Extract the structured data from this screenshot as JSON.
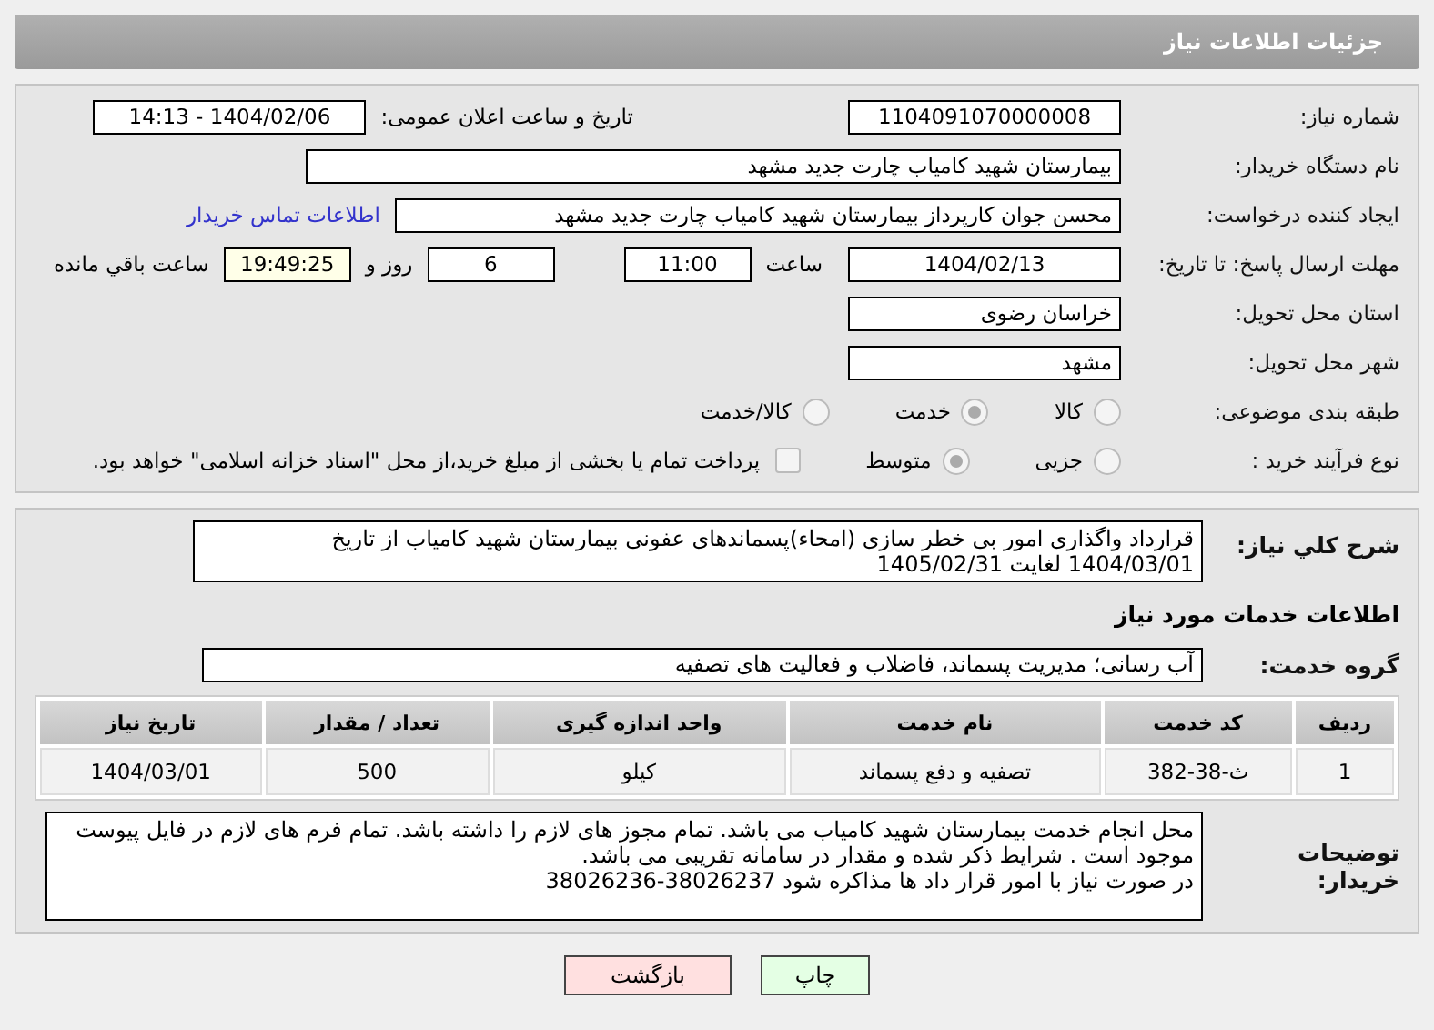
{
  "header": {
    "title": "جزئیات اطلاعات نیاز"
  },
  "info": {
    "need_number": {
      "label": "شماره نیاز:",
      "value": "1104091070000008"
    },
    "announce": {
      "label": "تاریخ و ساعت اعلان عمومی:",
      "value": "1404/02/06 - 14:13"
    },
    "buyer": {
      "label": "نام دستگاه خریدار:",
      "value": "بیمارستان شهید کامیاب چارت جدید مشهد"
    },
    "creator": {
      "label": "ایجاد کننده درخواست:",
      "value": "محسن جوان کارپرداز بیمارستان شهید کامیاب چارت جدید مشهد",
      "link": "اطلاعات تماس خریدار"
    },
    "deadline": {
      "label": "مهلت ارسال پاسخ: تا تاریخ:",
      "date": "1404/02/13",
      "time_label": "ساعت",
      "time": "11:00",
      "days": "6",
      "days_label": "روز و",
      "remaining": "19:49:25",
      "remaining_label": "ساعت باقي مانده"
    },
    "province": {
      "label": "استان محل تحویل:",
      "value": "خراسان رضوی"
    },
    "city": {
      "label": "شهر محل تحویل:",
      "value": "مشهد"
    },
    "category": {
      "label": "طبقه بندی موضوعی:",
      "options": [
        {
          "label": "کالا",
          "selected": false
        },
        {
          "label": "خدمت",
          "selected": true
        },
        {
          "label": "کالا/خدمت",
          "selected": false
        }
      ]
    },
    "process": {
      "label": "نوع فرآیند خرید :",
      "options": [
        {
          "label": "جزیی",
          "selected": false
        },
        {
          "label": "متوسط",
          "selected": true
        }
      ],
      "payment": {
        "checked": false,
        "text": "پرداخت تمام یا بخشی از مبلغ خرید،از محل \"اسناد خزانه اسلامی\" خواهد بود."
      }
    }
  },
  "details": {
    "description": {
      "label": "شرح کلي نياز:",
      "value": "قرارداد واگذاری امور بی خطر سازی (امحاء)پسماندهای عفونی بیمارستان شهید کامیاب از تاریخ 1404/03/01 لغایت 1405/02/31"
    },
    "services_heading": "اطلاعات خدمات مورد نیاز",
    "service_group": {
      "label": "گروه خدمت:",
      "value": "آب رسانی؛ مدیریت پسماند، فاضلاب و فعالیت های تصفیه"
    },
    "table": {
      "columns": [
        "ردیف",
        "کد خدمت",
        "نام خدمت",
        "واحد اندازه گیری",
        "تعداد / مقدار",
        "تاریخ نیاز"
      ],
      "rows": [
        [
          "1",
          "ث-38-382",
          "تصفیه و دفع پسماند",
          "کیلو",
          "500",
          "1404/03/01"
        ]
      ]
    },
    "notes": {
      "label": "توضیحات خریدار:",
      "value": "محل انجام خدمت بیمارستان شهید کامیاب می باشد. تمام مجوز های لازم را داشته باشد. تمام فرم های لازم در فایل پیوست موجود است . شرایط ذکر شده و مقدار در سامانه تقریبی می باشد.\nدر صورت نیاز با امور قرار داد ها مذاکره شود 38026237-38026236"
    }
  },
  "buttons": [
    {
      "label": "چاپ",
      "kind": "print"
    },
    {
      "label": "بازگشت",
      "kind": "back"
    }
  ]
}
